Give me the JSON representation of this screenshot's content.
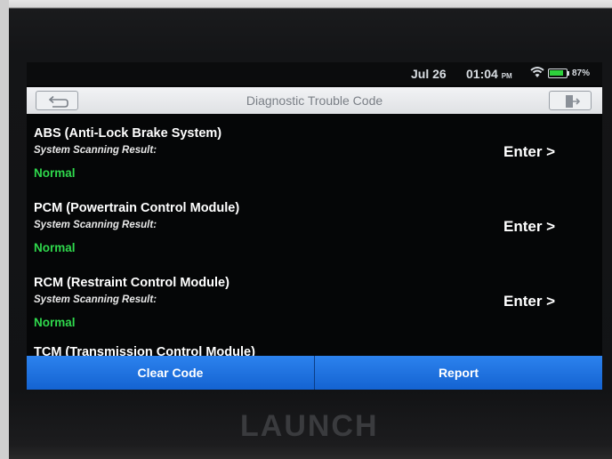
{
  "status_bar": {
    "date": "Jul 26",
    "time": "01:04",
    "ampm": "PM",
    "battery_percent_text": "87%",
    "battery_level": 0.87,
    "wifi_icon": "wifi-icon",
    "battery_icon": "battery-icon"
  },
  "title_bar": {
    "title": "Diagnostic Trouble Code",
    "back_icon": "back-arrow-icon",
    "exit_icon": "exit-icon"
  },
  "systems": [
    {
      "name": "ABS (Anti-Lock Brake System)",
      "scan_label": "System Scanning Result:",
      "status": "Normal",
      "action": "Enter >"
    },
    {
      "name": "PCM (Powertrain Control Module)",
      "scan_label": "System Scanning Result:",
      "status": "Normal",
      "action": "Enter >"
    },
    {
      "name": "RCM (Restraint Control Module)",
      "scan_label": "System Scanning Result:",
      "status": "Normal",
      "action": "Enter >"
    }
  ],
  "partial_item": "TCM (Transmission Control Module)",
  "buttons": {
    "clear_code": "Clear Code",
    "report": "Report"
  },
  "device_brand": "LAUNCH",
  "colors": {
    "status_normal": "#2fd84c",
    "button_blue": "#1f73e0",
    "screen_bg": "#050607"
  }
}
